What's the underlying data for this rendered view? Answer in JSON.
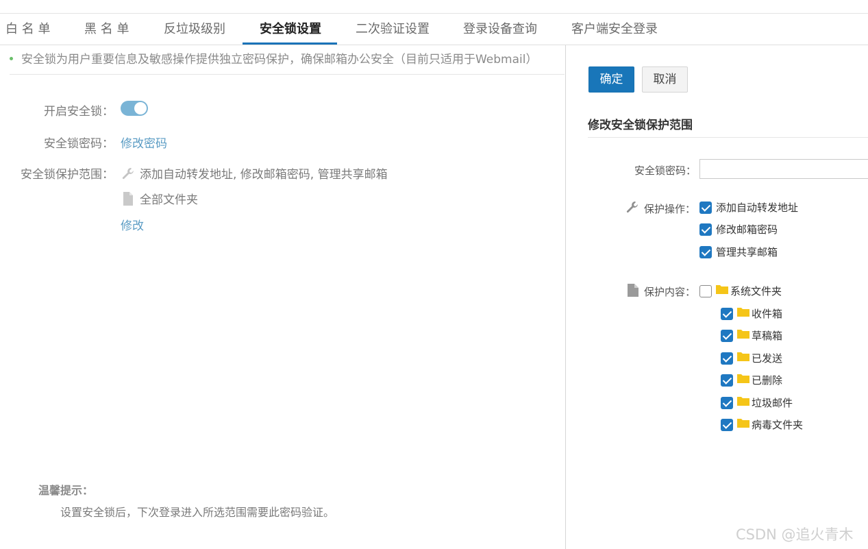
{
  "tabs": [
    {
      "label": "白 名 单"
    },
    {
      "label": "黑 名 单"
    },
    {
      "label": "反垃圾级别"
    },
    {
      "label": "安全锁设置"
    },
    {
      "label": "二次验证设置"
    },
    {
      "label": "登录设备查询"
    },
    {
      "label": "客户端安全登录"
    }
  ],
  "active_tab": "安全锁设置",
  "notice": "安全锁为用户重要信息及敏感操作提供独立密码保护，确保邮箱办公安全（目前只适用于Webmail）",
  "settings": {
    "enable_label": "开启安全锁：",
    "enable_on": true,
    "password_label": "安全锁密码：",
    "password_link": "修改密码",
    "scope_label": "安全锁保护范围：",
    "scope_ops": "添加自动转发地址, 修改邮箱密码, 管理共享邮箱",
    "scope_folders": "全部文件夹",
    "modify_link": "修改"
  },
  "tips": {
    "title": "温馨提示：",
    "text": "设置安全锁后，下次登录进入所选范围需要此密码验证。"
  },
  "panel": {
    "ok_label": "确定",
    "cancel_label": "取消",
    "title": "修改安全锁保护范围",
    "password_label": "安全锁密码：",
    "password_value": "",
    "ops_label": "保护操作：",
    "ops": [
      {
        "label": "添加自动转发地址",
        "checked": true
      },
      {
        "label": "修改邮箱密码",
        "checked": true
      },
      {
        "label": "管理共享邮箱",
        "checked": true
      }
    ],
    "content_label": "保护内容：",
    "root_folder": {
      "label": "系统文件夹",
      "checked": false
    },
    "folders": [
      {
        "label": "收件箱",
        "checked": true
      },
      {
        "label": "草稿箱",
        "checked": true
      },
      {
        "label": "已发送",
        "checked": true
      },
      {
        "label": "已删除",
        "checked": true
      },
      {
        "label": "垃圾邮件",
        "checked": true
      },
      {
        "label": "病毒文件夹",
        "checked": true
      }
    ]
  },
  "colors": {
    "accent": "#1976b9",
    "toggle": "#7ab4d6",
    "link": "#5b9cc4",
    "folder": "#f5c518"
  },
  "watermark": "CSDN @追火青木"
}
